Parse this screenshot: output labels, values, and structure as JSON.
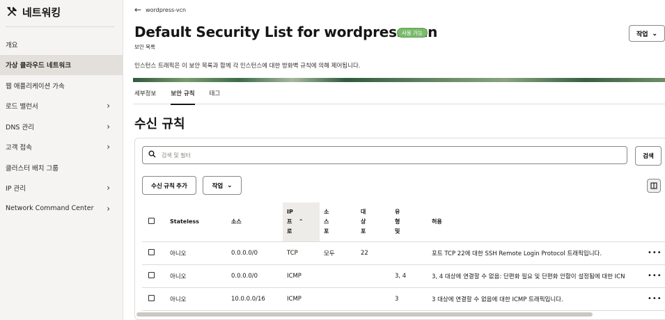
{
  "sidebar": {
    "title": "네트워킹",
    "items": [
      {
        "label": "개요",
        "chevron": false,
        "active": false
      },
      {
        "label": "가상 클라우드 네트워크",
        "chevron": false,
        "active": true
      },
      {
        "label": "웹 애플리케이션 가속",
        "chevron": false,
        "active": false
      },
      {
        "label": "로드 밸런서",
        "chevron": true,
        "active": false
      },
      {
        "label": "DNS 관리",
        "chevron": true,
        "active": false
      },
      {
        "label": "고객 접속",
        "chevron": true,
        "active": false
      },
      {
        "label": "클러스터 배치 그룹",
        "chevron": false,
        "active": false
      },
      {
        "label": "IP 관리",
        "chevron": true,
        "active": false
      },
      {
        "label": "Network Command Center",
        "chevron": true,
        "active": false
      }
    ]
  },
  "header": {
    "back_label": "wordpress-vcn",
    "title": "Default Security List for wordpress-vcn",
    "status_badge": "사용 가능",
    "subtitle": "보안 목록",
    "description": "인스턴스 트래픽은 이 보안 목록과 함께 각 인스턴스에 대한 방화벽 규칙에 의해 제어됩니다.",
    "actions_label": "작업"
  },
  "tabs": [
    {
      "label": "세부정보",
      "active": false
    },
    {
      "label": "보안 규칙",
      "active": true
    },
    {
      "label": "태그",
      "active": false
    }
  ],
  "section": {
    "title": "수신 규칙",
    "search_placeholder": "검색 및 필터",
    "search_button": "검색",
    "add_rule_button": "수신 규칙 추가",
    "actions_button": "작업"
  },
  "table": {
    "headers": {
      "stateless": "Stateless",
      "source": "소스",
      "ip_protocol": [
        "IP",
        "프",
        "로"
      ],
      "source_port": [
        "소",
        "스",
        "포"
      ],
      "dest_port": [
        "대",
        "상",
        "포"
      ],
      "type": [
        "유",
        "형",
        "및"
      ],
      "allow": "허용"
    },
    "rows": [
      {
        "stateless": "아니오",
        "source": "0.0.0.0/0",
        "protocol": "TCP",
        "source_port": "모두",
        "dest_port": "22",
        "type": "",
        "allow": "포트 TCP 22에 대한 SSH Remote Login Protocol 트래픽입니다."
      },
      {
        "stateless": "아니오",
        "source": "0.0.0.0/0",
        "protocol": "ICMP",
        "source_port": "",
        "dest_port": "",
        "type": "3, 4",
        "allow": "3, 4 대상에 연결할 수 없음: 단편화 필요 및 단편화 안함이 설정됨에 대한 ICN"
      },
      {
        "stateless": "아니오",
        "source": "10.0.0.0/16",
        "protocol": "ICMP",
        "source_port": "",
        "dest_port": "",
        "type": "3",
        "allow": "3 대상에 연결할 수 없음에 대한 ICMP 트래픽입니다."
      }
    ]
  },
  "colors": {
    "badge_green": "#7bbb6b",
    "sidebar_bg": "#f5f4f2",
    "active_item_bg": "#e3e0db"
  }
}
